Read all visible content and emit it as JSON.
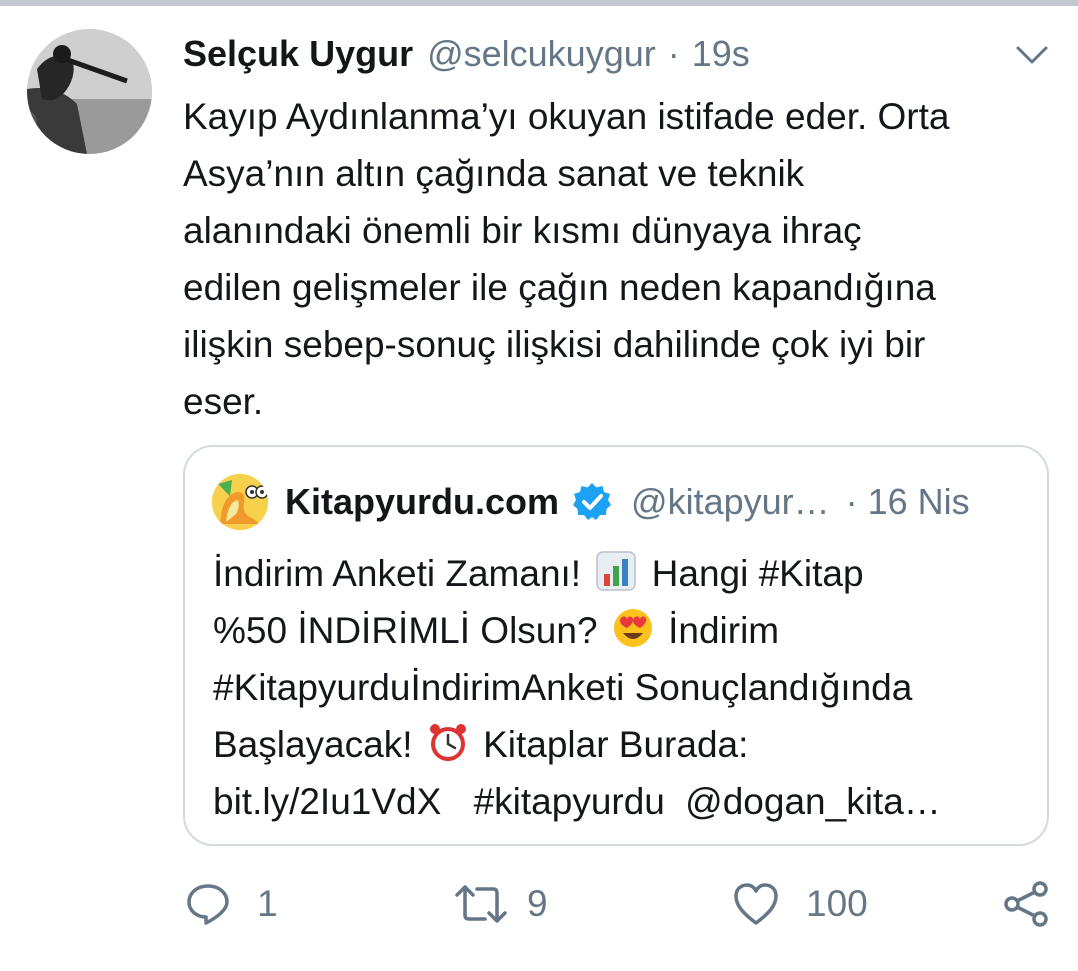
{
  "tweet": {
    "author_name": "Selçuk Uygur",
    "author_handle": "@selcukuygur",
    "separator": "·",
    "time": "19s",
    "text": "Kayıp Aydınlanma’yı okuyan istifade eder. Orta\nAsya’nın altın çağında sanat ve teknik\nalanındaki önemli bir kısmı dünyaya ihraç\nedilen gelişmeler ile çağın neden kapandığına\nilişkin sebep-sonuç ilişkisi dahilinde çok iyi bir\neser."
  },
  "quoted": {
    "author_name": "Kitapyurdu.com",
    "author_handle": "@kitapyur…",
    "separator": "·",
    "time": "16 Nis",
    "line1_a": "İndirim Anketi Zamanı!",
    "line1_b": "Hangi #Kitap",
    "line2_a": "%50 İNDİRİMLİ Olsun?",
    "line2_b": "İndirim",
    "line3": "#KitapyurduİndirimAnketi Sonuçlandığında",
    "line4_a": "Başlayacak!",
    "line4_b": "Kitaplar Burada:",
    "line5_a": "bit.ly/2Iu1VdX",
    "line5_b": "#kitapyurdu",
    "line5_c": "@dogan_kita…"
  },
  "actions": {
    "replies": "1",
    "retweets": "9",
    "likes": "100"
  },
  "icons": {
    "menu": "chevron-down-icon",
    "verified": "verified-badge-icon",
    "reply": "reply-icon",
    "retweet": "retweet-icon",
    "like": "heart-icon",
    "share": "share-icon"
  },
  "colors": {
    "text": "#14171a",
    "secondary": "#657786",
    "verified": "#1da1f2",
    "border": "#d3dae0"
  }
}
